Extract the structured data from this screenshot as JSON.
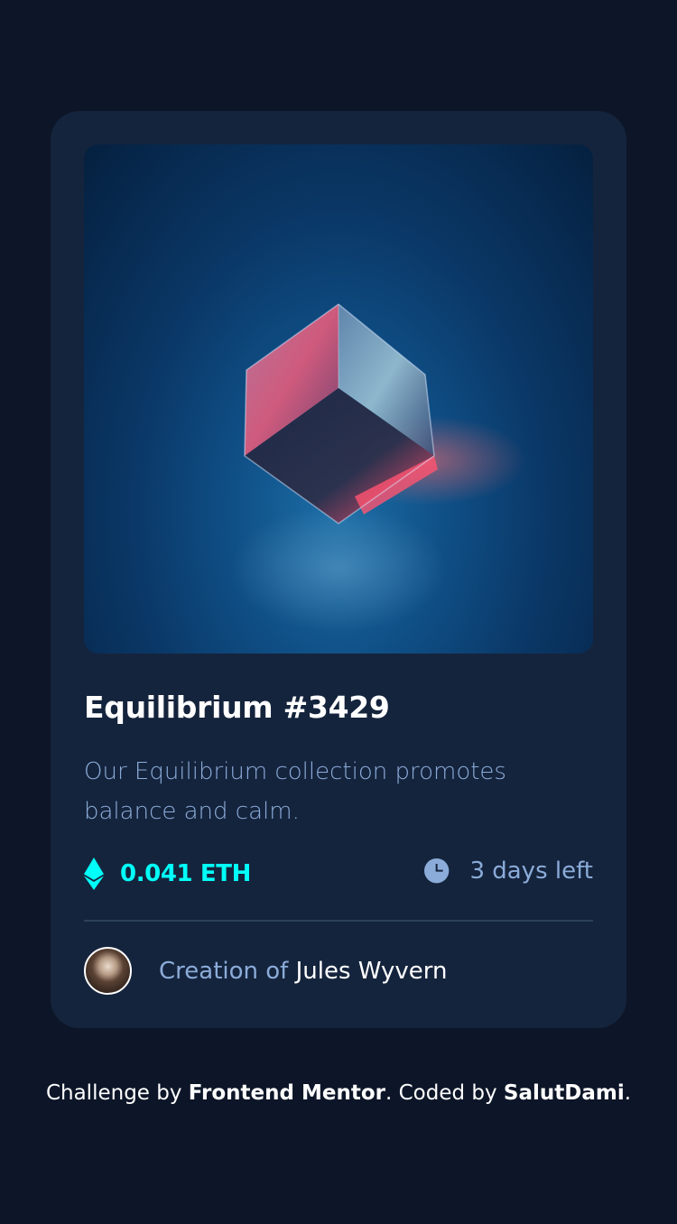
{
  "card": {
    "title": "Equilibrium #3429",
    "description": "Our Equilibrium collection promotes balance and calm.",
    "price": "0.041 ETH",
    "time_left": "3 days left",
    "creator_prefix": "Creation of",
    "creator_name": "Jules Wyvern"
  },
  "footer": {
    "challenge_prefix": "Challenge by",
    "challenge_link": "Frontend Mentor",
    "coded_prefix": ". Coded by",
    "coded_link": "SalutDami",
    "suffix": "."
  },
  "icons": {
    "price": "ethereum-icon",
    "time": "clock-icon"
  },
  "colors": {
    "background": "#0d1628",
    "card": "#15243d",
    "accent": "#00fff8",
    "muted": "#8bacd9"
  }
}
